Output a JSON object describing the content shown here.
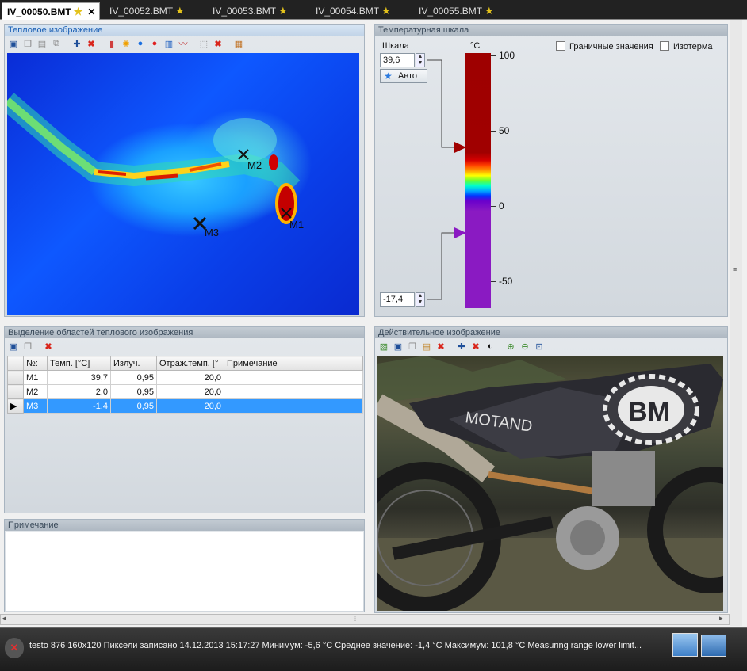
{
  "tabs": [
    {
      "label": "IV_00050.BMT",
      "active": true
    },
    {
      "label": "IV_00052.BMT",
      "active": false
    },
    {
      "label": "IV_00053.BMT",
      "active": false
    },
    {
      "label": "IV_00054.BMT",
      "active": false
    },
    {
      "label": "IV_00055.BMT",
      "active": false
    }
  ],
  "thermal_panel": {
    "title": "Тепловое изображение",
    "markers": [
      {
        "label": "M1"
      },
      {
        "label": "M2"
      },
      {
        "label": "M3"
      }
    ]
  },
  "scale_panel": {
    "title": "Температурная шкала",
    "scale_label": "Шкала",
    "unit": "°C",
    "max_value": "39,6",
    "min_value": "-17,4",
    "auto_button": "Авто",
    "limit_values_label": "Граничные значения",
    "isotherm_label": "Изотерма",
    "ticks": [
      "100",
      "50",
      "0",
      "-50"
    ]
  },
  "areas_panel": {
    "title": "Выделение областей теплового изображения",
    "columns": [
      "№:",
      "Темп. [°C]",
      "Излуч.",
      "Отраж.темп. [°",
      "Примечание"
    ],
    "rows": [
      {
        "id": "M1",
        "temp": "39,7",
        "emissivity": "0,95",
        "reflected": "20,0",
        "note": ""
      },
      {
        "id": "M2",
        "temp": "2,0",
        "emissivity": "0,95",
        "reflected": "20,0",
        "note": ""
      },
      {
        "id": "M3",
        "temp": "-1,4",
        "emissivity": "0,95",
        "reflected": "20,0",
        "note": "",
        "selected": true
      }
    ]
  },
  "note_panel": {
    "title": "Примечание"
  },
  "photo_panel": {
    "title": "Действительное изображение",
    "brand_text": "MOTAND",
    "logo_text": "BM"
  },
  "status": {
    "text": "testo  876 160x120  Пиксели записано 14.12.2013  15:17:27  Минимум: -5,6 °C  Среднее значение: -1,4 °C  Максимум: 101,8 °C  Measuring range lower limit..."
  },
  "colors": {
    "accent": "#1a5fb4",
    "selection": "#3399ff",
    "upper_arrow": "#a00000",
    "lower_arrow": "#8a1ac2"
  }
}
